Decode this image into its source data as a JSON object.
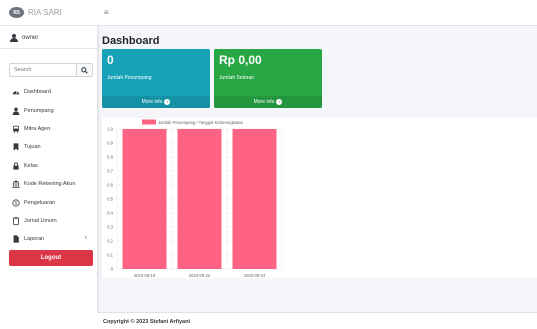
{
  "brand": {
    "logo_text": "RS",
    "name": "RIA SARI"
  },
  "user": {
    "name": "owner"
  },
  "search": {
    "placeholder": "Search"
  },
  "nav": {
    "items": [
      {
        "label": "Dashboard",
        "icon": "dashboard-icon"
      },
      {
        "label": "Penumpang",
        "icon": "user-icon"
      },
      {
        "label": "Mitra Agen",
        "icon": "bus-icon"
      },
      {
        "label": "Tujuan",
        "icon": "bookmark-icon"
      },
      {
        "label": "Kelas",
        "icon": "lock-icon"
      },
      {
        "label": "Kode Rekening Akun",
        "icon": "bank-icon"
      },
      {
        "label": "Pengeluaran",
        "icon": "money-icon"
      },
      {
        "label": "Jurnal Umum",
        "icon": "clipboard-icon"
      },
      {
        "label": "Laporan",
        "icon": "file-icon"
      }
    ],
    "logout": "Logout"
  },
  "topbar": {
    "menu_icon": "≡"
  },
  "page": {
    "title": "Dashboard"
  },
  "boxes": [
    {
      "value": "0",
      "label": "Jumlah Penumpang",
      "more": "More info"
    },
    {
      "value": "Rp 0,00",
      "label": "Jumlah Setoran",
      "more": "More info"
    }
  ],
  "chart_data": {
    "type": "bar",
    "categories": [
      "2023-08-19",
      "2023-08-22",
      "2023-08-24"
    ],
    "series": [
      {
        "name": "Jumlah Penumpang / Tanggal Keberangkatan",
        "values": [
          1,
          1,
          1
        ]
      }
    ],
    "ylim": [
      0,
      1.0
    ],
    "yticks": [
      "0",
      "0.1",
      "0.2",
      "0.3",
      "0.4",
      "0.5",
      "0.6",
      "0.7",
      "0.8",
      "0.9",
      "1.0"
    ],
    "color": "#ff6384",
    "legend": "top"
  },
  "footer": {
    "copyright": "Copyright © 2023 Stefani Arfiyani"
  }
}
